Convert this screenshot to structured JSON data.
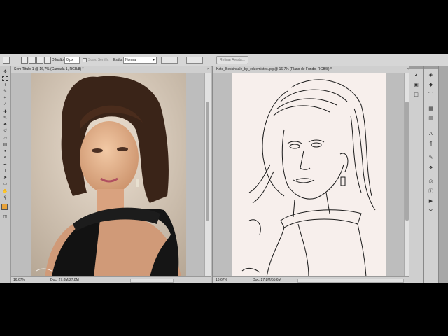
{
  "options_bar": {
    "feather_label": "Difusão:",
    "feather_value": "0 px",
    "antialias_label": "Suav. Serrilh.",
    "style_label": "Estilo:",
    "style_value": "Normal",
    "refine_button": "Refinar Aresta..."
  },
  "documents": [
    {
      "tab_title": "Sem Título-1 @ 16,7% (Camada 1, RGB/8) *",
      "zoom": "16,67%",
      "doc_info": "Doc: 27,8M/27,8M",
      "close": "×"
    },
    {
      "tab_title": "Kate_Beckinsale_by_eduemistes.jpg @ 16,7% (Plano de Fundo, RGB/8) *",
      "zoom": "16,67%",
      "doc_info": "Doc: 27,8M/55,6M",
      "close": "×"
    }
  ],
  "toolbox": {
    "tools": [
      "move",
      "marquee",
      "lasso",
      "quick-select",
      "crop",
      "eyedropper",
      "healing",
      "brush",
      "clone-stamp",
      "history-brush",
      "eraser",
      "gradient",
      "blur",
      "dodge",
      "pen",
      "type",
      "path-select",
      "shape",
      "hand",
      "zoom"
    ],
    "foreground_color": "#e8a33a",
    "background_color": "#ffffff"
  },
  "dock": {
    "panels": [
      "layers",
      "channels",
      "paths",
      "adjustments",
      "masks",
      "character",
      "paragraph",
      "brushes",
      "clone-source",
      "styles",
      "swatches",
      "navigator",
      "histogram",
      "info"
    ]
  }
}
